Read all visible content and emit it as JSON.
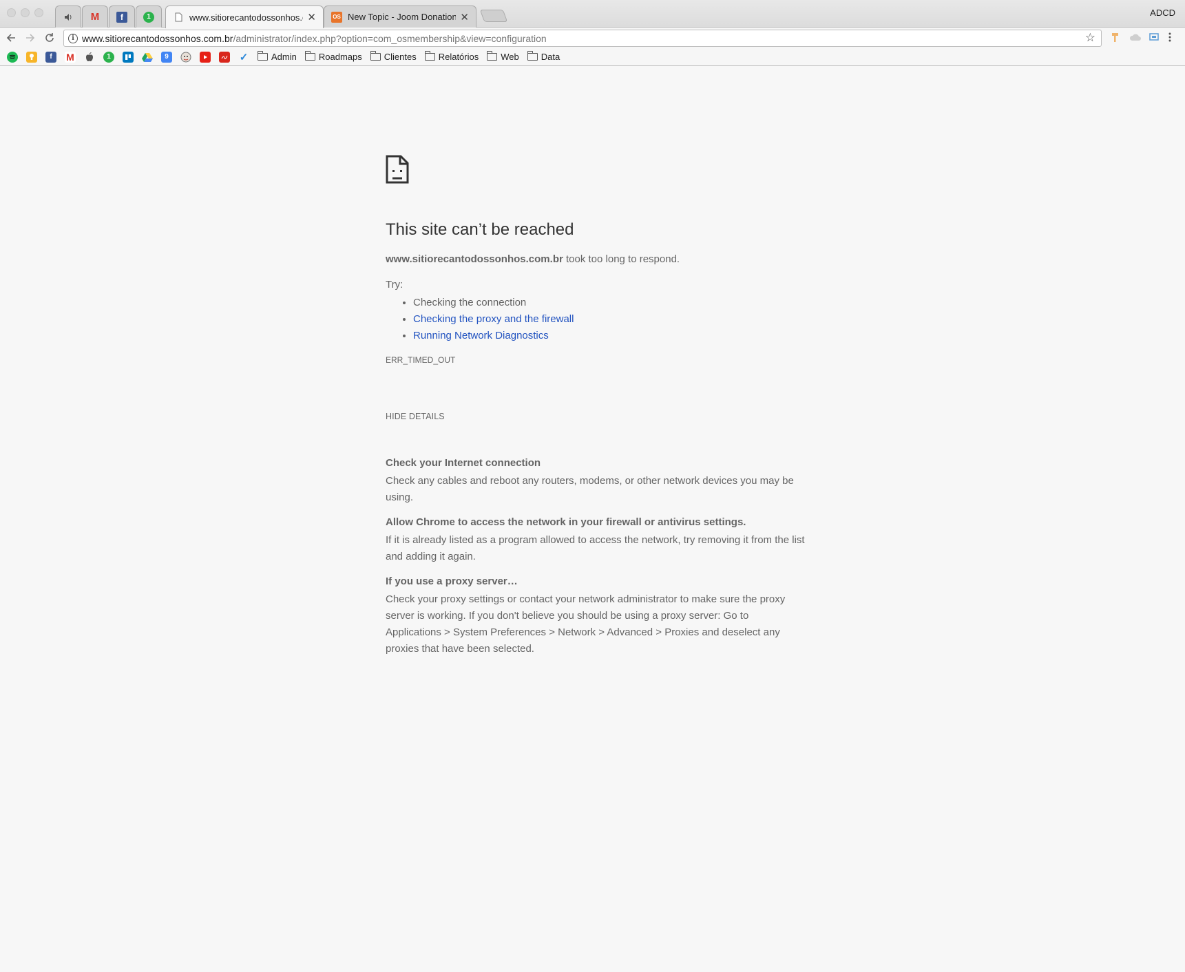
{
  "browser": {
    "profile_name": "ADCD",
    "tabs": [
      {
        "type": "pinned",
        "icon": "speaker-icon",
        "glyph": "🔈"
      },
      {
        "type": "pinned",
        "icon": "gmail-icon",
        "glyph": "M"
      },
      {
        "type": "pinned",
        "icon": "facebook-icon",
        "glyph": "f"
      },
      {
        "type": "pinned",
        "icon": "1password-icon",
        "glyph": "1"
      },
      {
        "type": "normal",
        "title": "www.sitiorecantodossonhos.co",
        "active": true
      },
      {
        "type": "normal",
        "title": "New Topic - Joom Donation - .",
        "active": false,
        "icon_label": "OS"
      }
    ],
    "address": {
      "host": "www.sitiorecantodossonhos.com.br",
      "path": "/administrator/index.php?option=com_osmembership&view=configuration"
    },
    "bookmarks": {
      "icons": [
        "spotify-icon",
        "keep-icon",
        "facebook-icon",
        "gmail-icon",
        "apple-icon",
        "1password-icon",
        "trello-icon",
        "drive-icon",
        "calendar-icon",
        "github-icon",
        "youtube-icon",
        "pdf-icon",
        "wunderlist-icon"
      ],
      "calendar_day": "9",
      "folders": [
        "Admin",
        "Roadmaps",
        "Clientes",
        "Relatórios",
        "Web",
        "Data"
      ]
    }
  },
  "error": {
    "title": "This site can’t be reached",
    "host": "www.sitiorecantodossonhos.com.br",
    "message": " took too long to respond.",
    "try_label": "Try:",
    "suggestions": [
      {
        "text": "Checking the connection",
        "link": false
      },
      {
        "text": "Checking the proxy and the firewall",
        "link": true
      },
      {
        "text": "Running Network Diagnostics",
        "link": true
      }
    ],
    "code": "ERR_TIMED_OUT",
    "details_button": "HIDE DETAILS",
    "details": [
      {
        "heading": "Check your Internet connection",
        "body": "Check any cables and reboot any routers, modems, or other network devices you may be using."
      },
      {
        "heading": "Allow Chrome to access the network in your firewall or antivirus settings.",
        "body": "If it is already listed as a program allowed to access the network, try removing it from the list and adding it again."
      },
      {
        "heading": "If you use a proxy server…",
        "body": "Check your proxy settings or contact your network administrator to make sure the proxy server is working. If you don't believe you should be using a proxy server: Go to Applications > System Preferences > Network > Advanced > Proxies and deselect any proxies that have been selected."
      }
    ]
  },
  "colors": {
    "link": "#2253c0",
    "page_background": "#f7f7f7",
    "text": "#646464"
  }
}
